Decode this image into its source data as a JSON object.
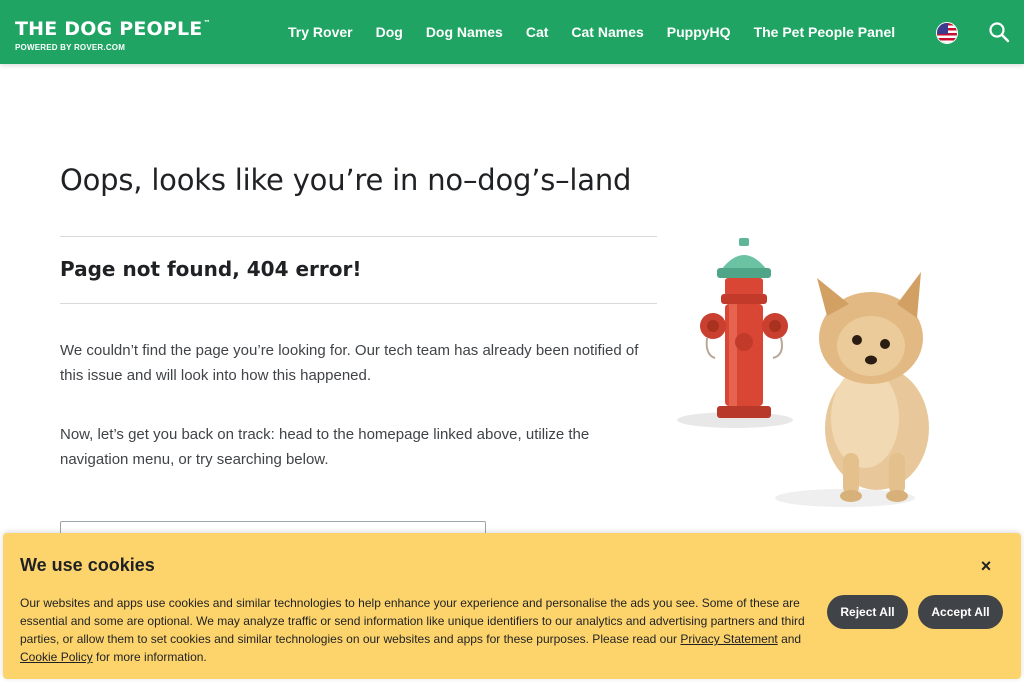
{
  "header": {
    "brand_name": "THE DOG PEOPLE",
    "brand_tm": "™",
    "brand_sub": "POWERED BY ROVER.COM",
    "nav": [
      "Try Rover",
      "Dog",
      "Dog Names",
      "Cat",
      "Cat Names",
      "PuppyHQ",
      "The Pet People Panel"
    ],
    "flag_icon": "us-flag-icon",
    "search_icon": "search-icon",
    "bg_color": "#1fa463"
  },
  "main": {
    "title": "Oops, looks like you’re in no–dog’s–land",
    "subtitle": "Page not found, 404 error!",
    "para1": "We couldn’t find the page you’re looking for. Our tech team has already been notified of this issue and will look into how this happened.",
    "para2": "Now, let’s get you back on track: head to the homepage linked above, utilize the navigation menu, or try searching below.",
    "search_value": ""
  },
  "illustration": {
    "icons": [
      "fire-hydrant-icon",
      "pomeranian-dog-icon"
    ]
  },
  "cookie": {
    "title": "We use cookies",
    "close_label": "×",
    "text_before": "Our websites and apps use cookies and similar technologies to help enhance your experience and personalise the ads you see. Some of these are essential and some are optional. We may analyze traffic or send information like unique identifiers to our analytics and advertising partners and third parties, or allow them to set cookies and similar technologies on our websites and apps for these purposes. Please read our ",
    "privacy_link": "Privacy Statement",
    "text_and": " and ",
    "cookie_link": "Cookie Policy",
    "text_after": " for more information.",
    "reject_label": "Reject All",
    "accept_label": "Accept All",
    "bg_color": "#fdd46b",
    "button_color": "#404347"
  }
}
